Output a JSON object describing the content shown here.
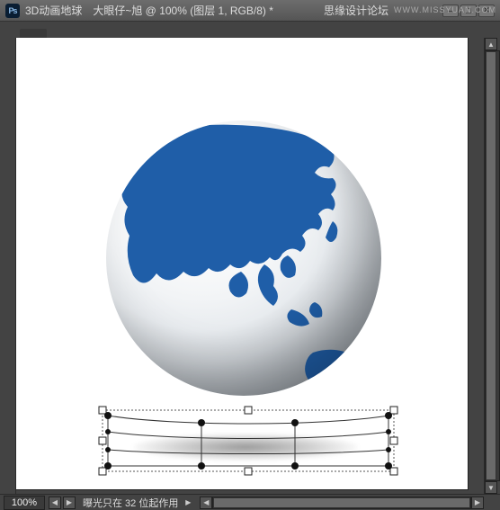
{
  "app": {
    "icon_label": "Ps"
  },
  "titlebar": {
    "doc_title": "3D动画地球　大眼仔~旭 @ 100% (图层 1, RGB/8) *",
    "right_text": "思缘设计论坛"
  },
  "watermark": "WWW.MISSYUAN.COM",
  "status": {
    "zoom": "100%",
    "text": "曝光只在 32 位起作用"
  },
  "colors": {
    "land": "#1f5ea8",
    "ocean": "#eef1f4"
  }
}
